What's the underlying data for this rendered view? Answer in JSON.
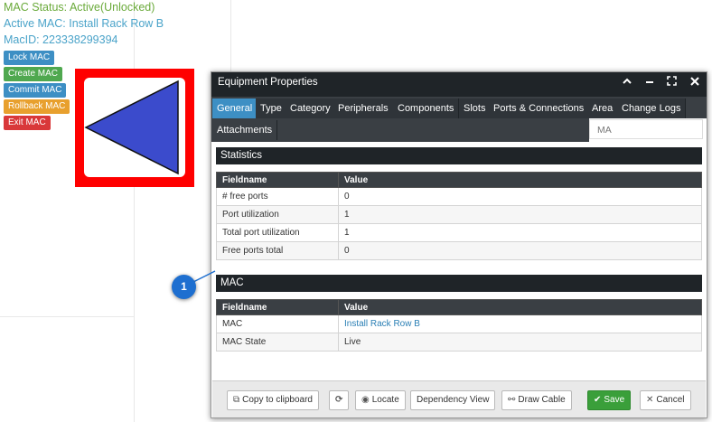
{
  "mac_panel": {
    "status": "MAC Status: Active(Unlocked)",
    "active": "Active MAC: Install Rack Row B",
    "mac_id": "MacID: 223338299394",
    "buttons": [
      {
        "label": "Lock MAC",
        "color": "#3d8fc4"
      },
      {
        "label": "Create MAC",
        "color": "#4fa84f"
      },
      {
        "label": "Commit MAC",
        "color": "#3d8fc4"
      },
      {
        "label": "Rollback MAC",
        "color": "#e8a02e"
      },
      {
        "label": "Exit MAC",
        "color": "#d9383a"
      }
    ]
  },
  "preview": {
    "border_color": "#ff0000",
    "shape_color": "#3b4bcc",
    "shape": "triangle-left"
  },
  "dialog": {
    "title": "Equipment Properties",
    "controls": [
      "chevron-up-icon",
      "minimize-icon",
      "expand-icon",
      "close-icon"
    ],
    "tabs_row1": [
      "General",
      "Type",
      "Category",
      "Peripherals",
      "Components",
      "Slots",
      "Ports & Connections",
      "Area",
      "Change Logs"
    ],
    "tabs_row2": [
      "Attachments"
    ],
    "active_tab": "General",
    "filter_value": "MA",
    "statistics": {
      "title": "Statistics",
      "headers": [
        "Fieldname",
        "Value"
      ],
      "rows": [
        [
          "# free ports",
          "0"
        ],
        [
          "Port utilization",
          "1"
        ],
        [
          "Total port utilization",
          "1"
        ],
        [
          "Free ports total",
          "0"
        ]
      ]
    },
    "mac": {
      "title": "MAC",
      "headers": [
        "Fieldname",
        "Value"
      ],
      "rows": [
        [
          "MAC",
          "Install Rack Row B"
        ],
        [
          "MAC State",
          "Live"
        ]
      ]
    },
    "footer": {
      "copy": "Copy to clipboard",
      "locate": "Locate",
      "dependency": "Dependency View",
      "draw_cable": "Draw Cable",
      "save": "Save",
      "cancel": "Cancel"
    }
  },
  "callout": {
    "label": "1"
  }
}
